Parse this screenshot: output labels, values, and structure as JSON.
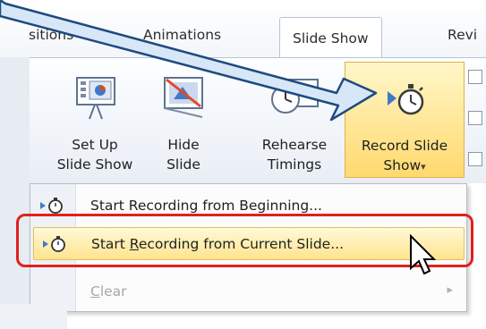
{
  "tabs": [
    {
      "label": "sitions"
    },
    {
      "label": "Animations"
    },
    {
      "label": "Slide Show"
    },
    {
      "label": "Revi"
    }
  ],
  "ribbon": {
    "setup": {
      "line1": "Set Up",
      "line2": "Slide Show",
      "icon": "setup-slideshow-icon"
    },
    "hide": {
      "line1": "Hide",
      "line2": "Slide",
      "icon": "hide-slide-icon"
    },
    "rehearse": {
      "line1": "Rehearse",
      "line2": "Timings",
      "icon": "rehearse-timings-icon"
    },
    "record": {
      "line1": "Record Slide",
      "line2": "Show",
      "dropdown": "▾",
      "icon": "record-stopwatch-icon"
    }
  },
  "menu": {
    "items": [
      {
        "label": "Start Recording from Beginning...",
        "icon": "record-stopwatch-icon",
        "state": "normal"
      },
      {
        "pre": "Start ",
        "underline": "R",
        "post": "ecording from Current Slide...",
        "icon": "record-stopwatch-icon",
        "state": "highlighted"
      },
      {
        "underline": "C",
        "post": "lear",
        "state": "disabled",
        "submenu": "▸"
      }
    ]
  },
  "colors": {
    "accent_red": "#e0201e",
    "highlight": "#ffd96e",
    "arrow": "#1e4a80"
  }
}
